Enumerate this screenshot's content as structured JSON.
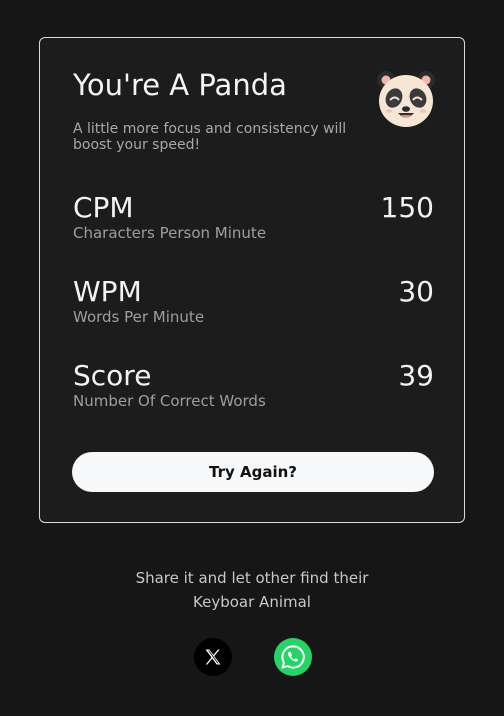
{
  "result": {
    "title": "You're A Panda",
    "message": "A little more focus and consistency will boost your speed!",
    "avatar_icon": "panda-face-icon"
  },
  "stats": [
    {
      "name": "CPM",
      "description": "Characters Person Minute",
      "value": "150"
    },
    {
      "name": "WPM",
      "description": "Words Per Minute",
      "value": "30"
    },
    {
      "name": "Score",
      "description": "Number Of Correct Words",
      "value": "39"
    }
  ],
  "actions": {
    "try_again_label": "Try Again?"
  },
  "share": {
    "line1": "Share it and let other find their",
    "line2": "Keyboar Animal",
    "x_icon": "x-logo-icon",
    "whatsapp_icon": "whatsapp-icon"
  },
  "colors": {
    "background": "#161616",
    "card": "#1c1c1c",
    "whatsapp": "#25d366",
    "x": "#000000"
  }
}
